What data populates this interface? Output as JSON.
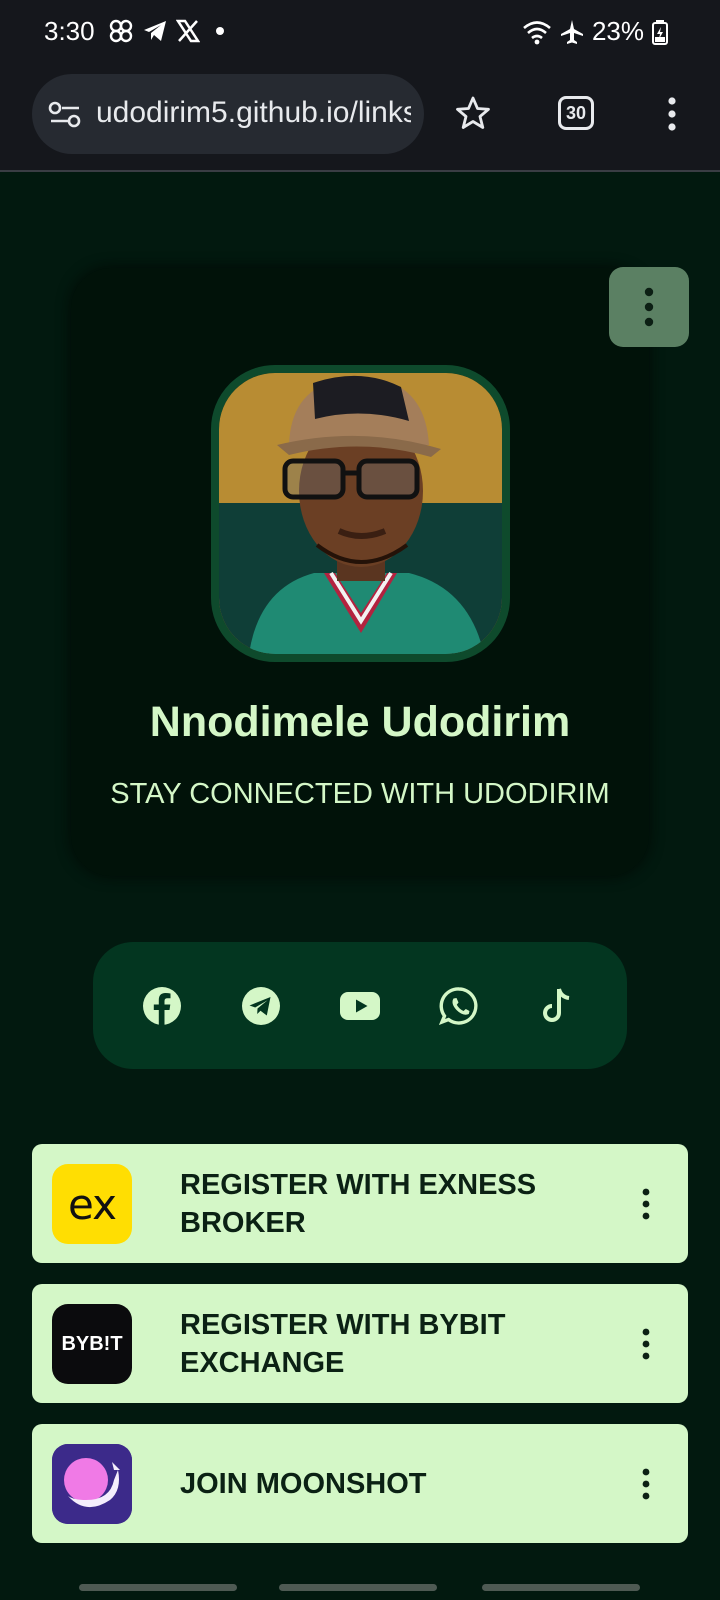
{
  "status_bar": {
    "time": "3:30",
    "battery": "23%",
    "left_icons": [
      "pinwheel-icon",
      "telegram-icon",
      "x-icon",
      "dot-icon"
    ],
    "right_icons": [
      "wifi-icon",
      "airplane-icon",
      "battery-icon"
    ]
  },
  "browser": {
    "url": "udodirim5.github.io/links",
    "tab_count": "30"
  },
  "profile": {
    "name": "Nnodimele Udodirim",
    "tagline": "STAY CONNECTED WITH UDODIRIM"
  },
  "socials": [
    {
      "name": "facebook-icon"
    },
    {
      "name": "telegram-icon"
    },
    {
      "name": "youtube-icon"
    },
    {
      "name": "whatsapp-icon"
    },
    {
      "name": "tiktok-icon"
    }
  ],
  "links": [
    {
      "label": "REGISTER WITH EXNESS BROKER",
      "logo": "ex"
    },
    {
      "label": "REGISTER WITH BYBIT EXCHANGE",
      "logo": "BYB!T"
    },
    {
      "label": "JOIN MOONSHOT",
      "logo": "moonshot"
    }
  ],
  "colors": {
    "page_bg": "#02190f",
    "accent_text": "#d4f7c7",
    "social_bar": "#033620",
    "link_card": "#d4f7c7"
  }
}
